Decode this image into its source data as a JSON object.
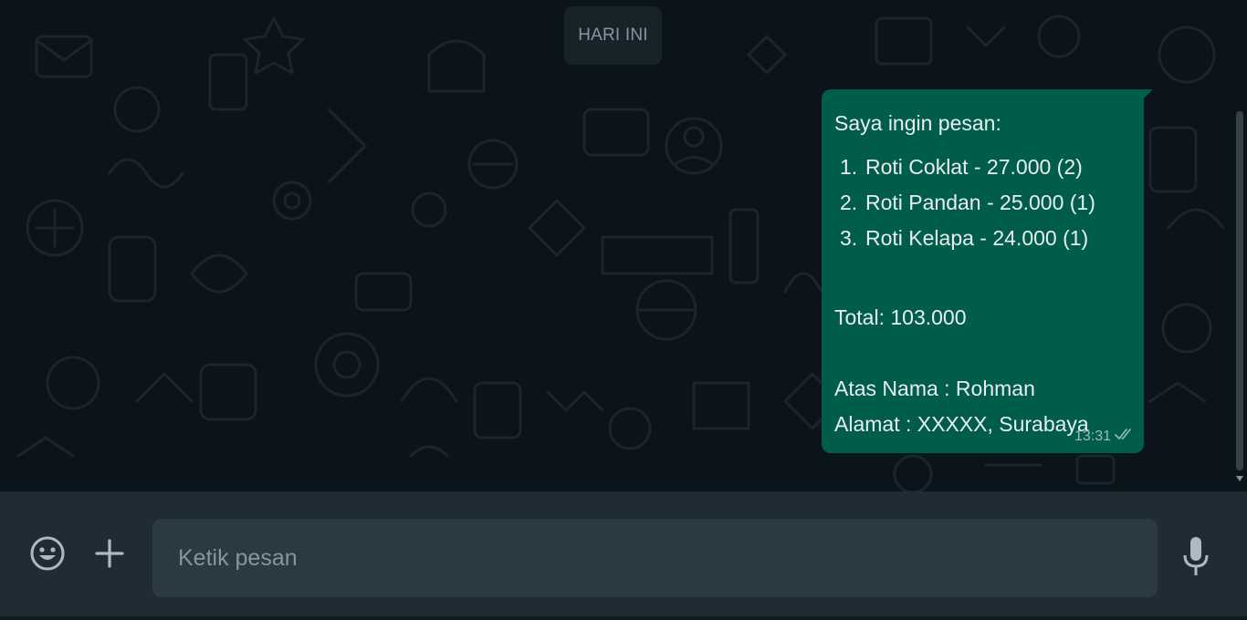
{
  "chat": {
    "date_chip": "HARI INI"
  },
  "message": {
    "greeting": "Saya ingin pesan:",
    "items": [
      {
        "num": "1.",
        "text": "Roti Coklat - 27.000 (2)"
      },
      {
        "num": "2.",
        "text": "Roti Pandan - 25.000 (1)"
      },
      {
        "num": "3.",
        "text": "Roti Kelapa - 24.000 (1)"
      }
    ],
    "total": "Total: 103.000",
    "name": "Atas Nama : Rohman",
    "address": "Alamat : XXXXX, Surabaya",
    "time": "13:31",
    "status_icon": "double-check-icon"
  },
  "composer": {
    "placeholder": "Ketik pesan",
    "value": "",
    "emoji_icon": "emoji-icon",
    "attach_icon": "plus-icon",
    "mic_icon": "microphone-icon"
  },
  "colors": {
    "chat_background": "#0b141a",
    "outgoing_bubble": "#005c4b",
    "composer_background": "#1f2c34",
    "input_background": "#2a3942",
    "date_chip_background": "#182229"
  }
}
